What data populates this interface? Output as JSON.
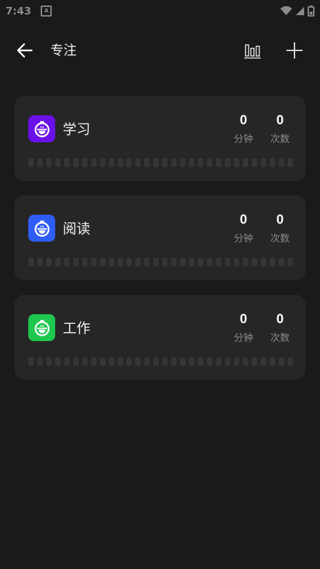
{
  "status_bar": {
    "time": "7:43",
    "notification_glyph": "A"
  },
  "app_bar": {
    "title": "专注"
  },
  "labels": {
    "minutes": "分钟",
    "count": "次数"
  },
  "tasks": [
    {
      "name": "学习",
      "minutes": "0",
      "count": "0",
      "color": "#6a10e8",
      "icon": "timer-icon"
    },
    {
      "name": "阅读",
      "minutes": "0",
      "count": "0",
      "color": "#2f5ef7",
      "icon": "timer-icon"
    },
    {
      "name": "工作",
      "minutes": "0",
      "count": "0",
      "color": "#1ec84e",
      "icon": "timer-icon"
    }
  ],
  "colors": {
    "background": "#1a1a1a",
    "card": "#262626",
    "heatmap_empty": "#353535"
  }
}
